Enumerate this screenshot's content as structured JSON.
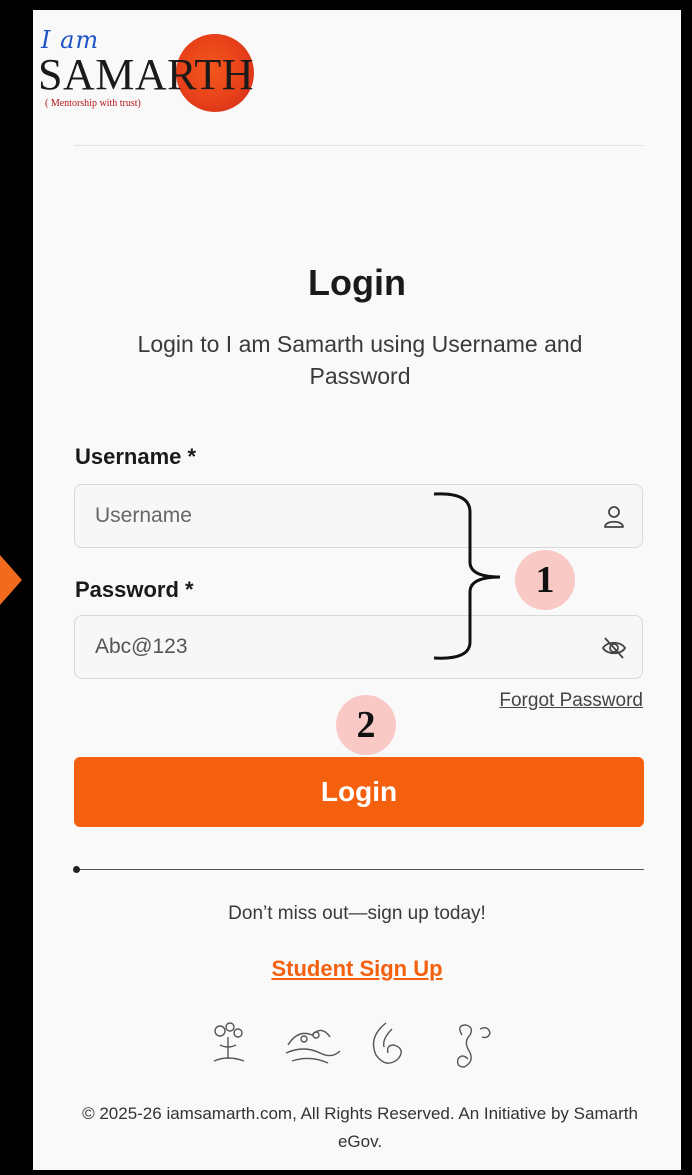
{
  "logo": {
    "top_text": "I am",
    "brand_text": "SAMARTH",
    "tagline": "( Mentorship with trust)"
  },
  "page": {
    "title": "Login",
    "subtitle": "Login to I am Samarth using Username and Password"
  },
  "form": {
    "username_label": "Username *",
    "username_placeholder": "Username",
    "username_icon": "user-icon",
    "password_label": "Password *",
    "password_value": "Abc@123",
    "password_icon": "eye-off-icon",
    "forgot_link": "Forgot Password",
    "login_button": "Login"
  },
  "annotations": {
    "marker_1": "1",
    "marker_2": "2"
  },
  "signup": {
    "prompt": "Don’t miss out—sign up today!",
    "link": "Student Sign Up"
  },
  "footer": {
    "text": "© 2025-26 iamsamarth.com, All Rights Reserved. An Initiative by Samarth eGov."
  },
  "colors": {
    "accent": "#f4600e",
    "background": "#f9f9f9",
    "frame": "#000000",
    "badge": "#f9c9c6"
  }
}
